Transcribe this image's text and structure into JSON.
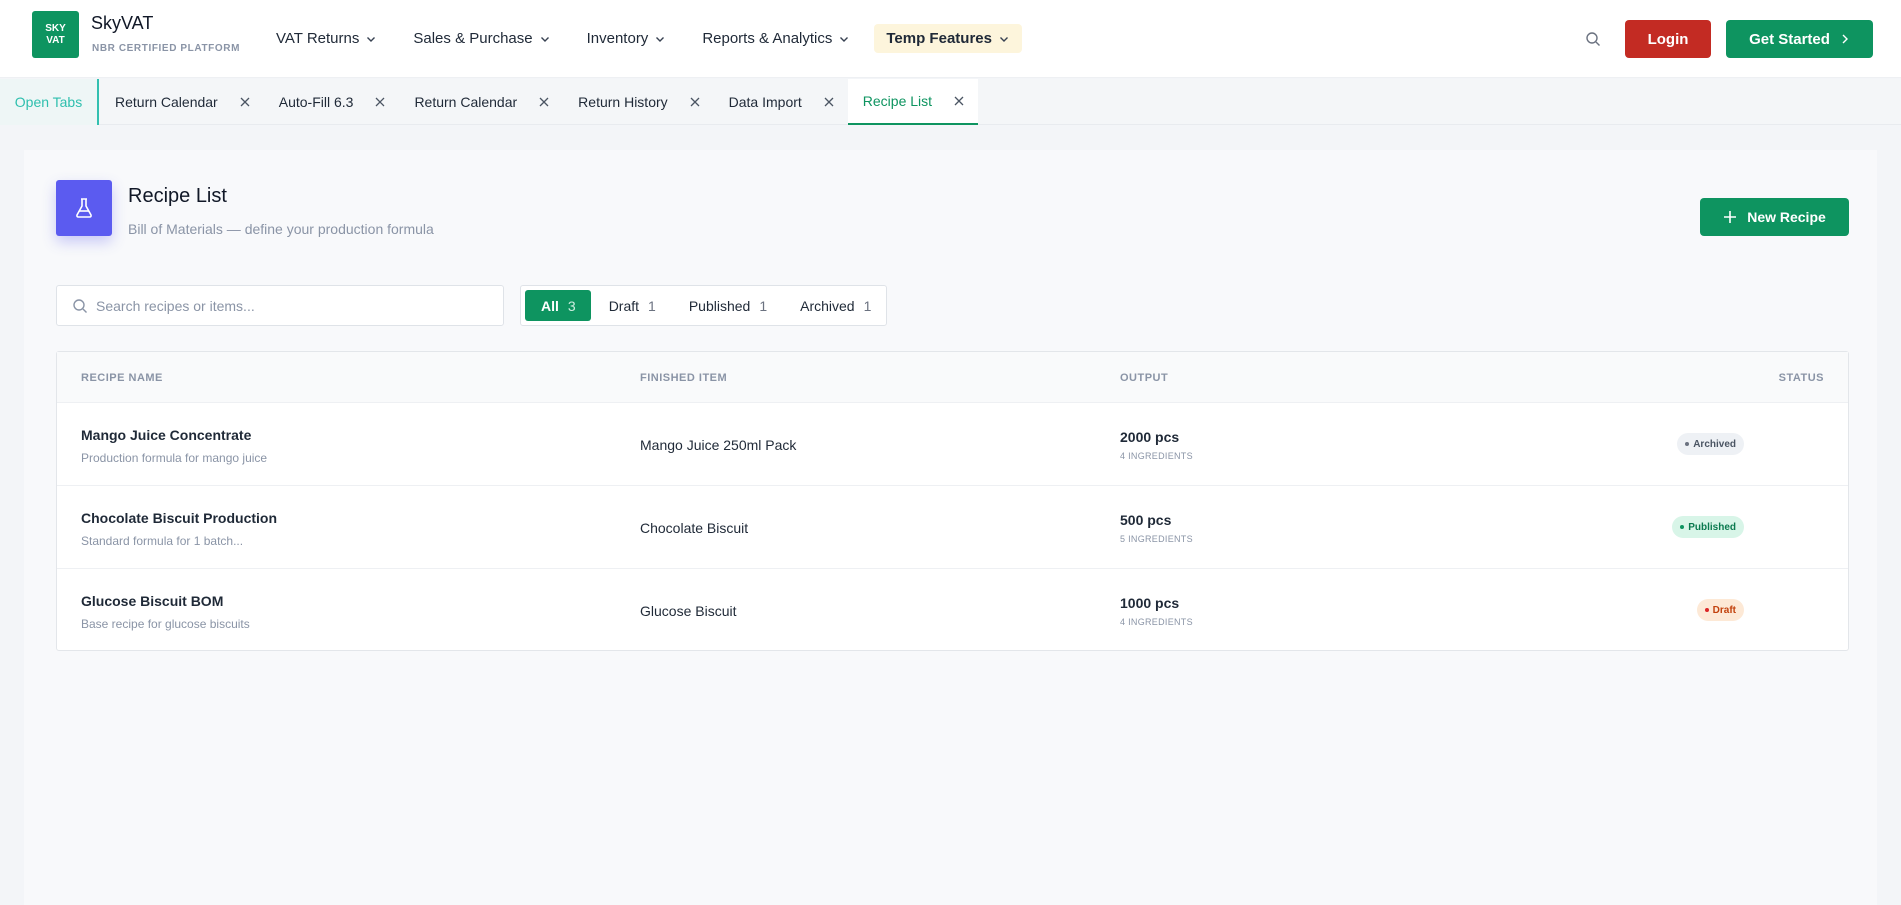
{
  "brand": {
    "logo_line1": "SKY",
    "logo_line2": "VAT",
    "name": "SkyVAT",
    "subtitle": "NBR CERTIFIED PLATFORM",
    "color": "#0e9460"
  },
  "nav": [
    {
      "label": "VAT Returns"
    },
    {
      "label": "Sales & Purchase"
    },
    {
      "label": "Inventory"
    },
    {
      "label": "Reports & Analytics"
    },
    {
      "label": "Temp Features"
    }
  ],
  "header_actions": {
    "search_icon": "search-icon",
    "login_label": "Login",
    "get_started_label": "Get Started"
  },
  "tabbar": {
    "open_tabs_label": "Open Tabs",
    "tabs": [
      {
        "label": "Return Calendar"
      },
      {
        "label": "Auto-Fill 6.3"
      },
      {
        "label": "Return Calendar"
      },
      {
        "label": "Return History"
      },
      {
        "label": "Data Import"
      },
      {
        "label": "Recipe List",
        "active": true
      }
    ]
  },
  "page": {
    "icon": "flask-icon",
    "title": "Recipe List",
    "subtitle": "Bill of Materials — define your production formula",
    "new_button_label": "New Recipe"
  },
  "search": {
    "placeholder": "Search recipes or items...",
    "value": ""
  },
  "filters": [
    {
      "label": "All",
      "count": "3",
      "active": true
    },
    {
      "label": "Draft",
      "count": "1"
    },
    {
      "label": "Published",
      "count": "1"
    },
    {
      "label": "Archived",
      "count": "1"
    }
  ],
  "table": {
    "columns": {
      "name": "RECIPE NAME",
      "item": "FINISHED ITEM",
      "output": "OUTPUT",
      "status": "STATUS"
    },
    "rows": [
      {
        "name": "Mango Juice Concentrate",
        "desc": "Production formula for mango juice",
        "item": "Mango Juice 250ml Pack",
        "output": "2000 pcs",
        "ingredients": "4 INGREDIENTS",
        "status": "Archived"
      },
      {
        "name": "Chocolate Biscuit Production",
        "desc": "Standard formula for 1 batch...",
        "item": "Chocolate Biscuit",
        "output": "500 pcs",
        "ingredients": "5 INGREDIENTS",
        "status": "Published"
      },
      {
        "name": "Glucose Biscuit BOM",
        "desc": "Base recipe for glucose biscuits",
        "item": "Glucose Biscuit",
        "output": "1000 pcs",
        "ingredients": "4 INGREDIENTS",
        "status": "Draft"
      }
    ]
  },
  "status_colors": {
    "Archived": {
      "bg": "#eef1f5",
      "fg": "#4b5563",
      "dot": "#6b7280"
    },
    "Published": {
      "bg": "#d8f5e8",
      "fg": "#0b7a4f",
      "dot": "#0e9460"
    },
    "Draft": {
      "bg": "#fde9d6",
      "fg": "#c2410c",
      "dot": "#dc2626"
    }
  }
}
